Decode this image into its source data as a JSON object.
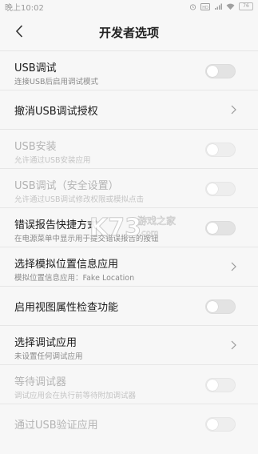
{
  "status_bar": {
    "time": "晚上10:02",
    "icons": [
      "alarm-icon",
      "sim-icon",
      "signal-icon",
      "wifi-icon"
    ],
    "battery": "76"
  },
  "header": {
    "title": "开发者选项"
  },
  "rows": [
    {
      "title": "USB调试",
      "subtitle": "连接USB后启用调试模式",
      "control": "toggle",
      "enabled": true
    },
    {
      "title": "撤消USB调试授权",
      "control": "chevron",
      "enabled": true
    },
    {
      "title": "USB安装",
      "subtitle": "允许通过USB安装应用",
      "control": "toggle",
      "enabled": false
    },
    {
      "title": "USB调试（安全设置）",
      "subtitle": "允许通过USB调试修改权限或模拟点击",
      "control": "toggle",
      "enabled": false
    },
    {
      "title": "错误报告快捷方式",
      "subtitle": "在电源菜单中显示用于提交错误报告的按钮",
      "control": "toggle",
      "enabled": true
    },
    {
      "title": "选择模拟位置信息应用",
      "subtitle": "模拟位置信息应用：Fake Location",
      "control": "chevron",
      "enabled": true
    },
    {
      "title": "启用视图属性检查功能",
      "control": "toggle",
      "enabled": true
    },
    {
      "title": "选择调试应用",
      "subtitle": "未设置任何调试应用",
      "control": "chevron",
      "enabled": true
    },
    {
      "title": "等待调试器",
      "subtitle": "调试应用会在执行前等待附加调试器",
      "control": "toggle",
      "enabled": false
    },
    {
      "title": "通过USB验证应用",
      "control": "toggle",
      "enabled": false
    }
  ],
  "watermark": {
    "logo": "K73",
    "text": "游戏之家",
    "domain": ".com"
  }
}
